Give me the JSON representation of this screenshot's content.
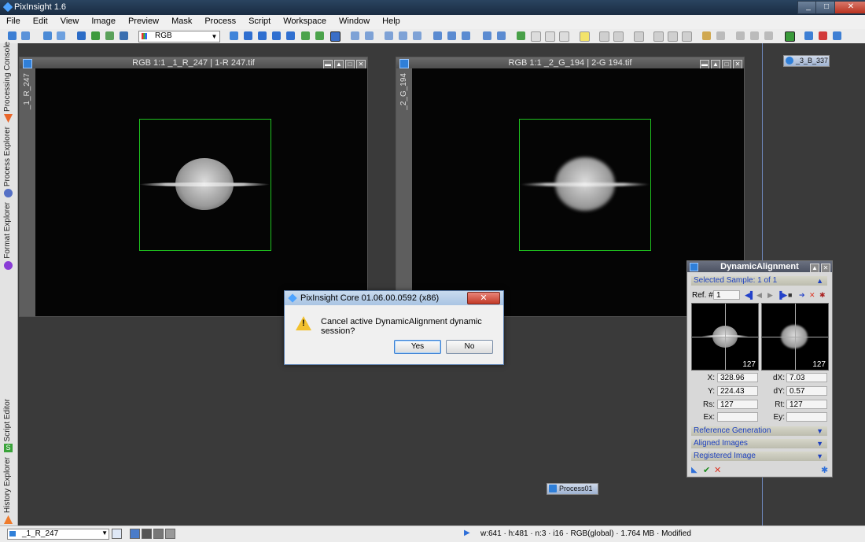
{
  "app": {
    "title": "PixInsight 1.6",
    "min": "_",
    "max": "□",
    "close": "✕"
  },
  "menu": [
    "File",
    "Edit",
    "View",
    "Image",
    "Preview",
    "Mask",
    "Process",
    "Script",
    "Workspace",
    "Window",
    "Help"
  ],
  "toolbar": {
    "channel_select": "RGB"
  },
  "sidebar": {
    "tabs": [
      {
        "label": "Processing Console"
      },
      {
        "label": "Process Explorer"
      },
      {
        "label": "Format Explorer"
      },
      {
        "label": "Script Editor"
      },
      {
        "label": "History Explorer"
      }
    ]
  },
  "windows": [
    {
      "title": "RGB 1:1 _1_R_247 | 1-R 247.tif",
      "id_label": "_1_R_247"
    },
    {
      "title": "RGB 1:1 _2_G_194 | 2-G 194.tif",
      "id_label": "_2_G_194"
    }
  ],
  "window_buttons": [
    "▬",
    "▲",
    "□",
    "✕"
  ],
  "iconized": {
    "image": "_3_B_337",
    "process": "Process01"
  },
  "dialog": {
    "title": "PixInsight Core 01.06.00.0592 (x86)",
    "close": "✕",
    "message": "Cancel active DynamicAlignment dynamic session?",
    "yes": "Yes",
    "no": "No",
    "warn_mark": "!"
  },
  "dynamic_alignment": {
    "title": "DynamicAlignment",
    "selected_sample": "Selected Sample: 1 of 1",
    "ref_label": "Ref. #:",
    "ref_value": "1",
    "thumb_left_count": "127",
    "thumb_right_count": "127",
    "fields": {
      "x_label": "X:",
      "x": "328.96",
      "y_label": "Y:",
      "y": "224.43",
      "rs_label": "Rs:",
      "rs": "127",
      "ex_label": "Ex:",
      "ex": "",
      "dx_label": "dX:",
      "dx": "7.03",
      "dy_label": "dY:",
      "dy": "0.57",
      "rt_label": "Rt:",
      "rt": "127",
      "ey_label": "Ey:",
      "ey": ""
    },
    "sections": {
      "reference_generation": "Reference Generation",
      "aligned_images": "Aligned Images",
      "registered_image": "Registered Image"
    },
    "chevron": "▼",
    "ok": "✔",
    "cancel": "✕",
    "reset": "✱"
  },
  "status": {
    "view": "_1_R_247",
    "text": "w:641 · h:481 · n:3 · i16 · RGB(global) · 1.764 MB · Modified"
  },
  "colors": {
    "roi": "#1fc31f",
    "accent": "#2f7fd8",
    "section_text": "#1c3fbf"
  }
}
